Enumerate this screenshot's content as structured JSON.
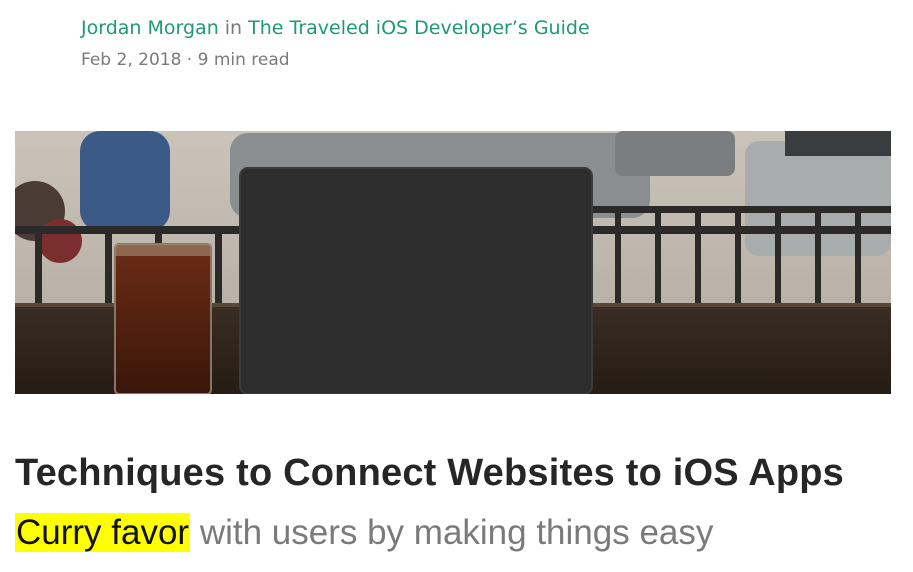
{
  "byline": {
    "author": "Jordan Morgan",
    "connector": "in",
    "publication": "The Traveled iOS Developer’s Guide"
  },
  "meta": {
    "date": "Feb 2, 2018",
    "separator": "·",
    "read_time": "9 min read"
  },
  "hero_image": {
    "description_icon": "laptop-photo"
  },
  "article": {
    "title": "Techniques to Connect Websites to iOS Apps",
    "subtitle_highlight": "Curry favor",
    "subtitle_rest": " with users by making things easy"
  },
  "colors": {
    "link": "#1e9a72",
    "muted": "#7a7a7a",
    "title": "#262626",
    "highlight": "#ffff00"
  }
}
